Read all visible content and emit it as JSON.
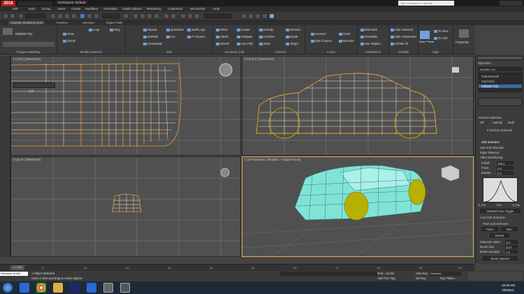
{
  "app": {
    "logo": "2016",
    "workspace": "Workspace: Default",
    "search_placeholder": "Type a keyword or phrase"
  },
  "menu": [
    "Edit",
    "Tools",
    "Group",
    "Views",
    "Create",
    "Modifiers",
    "Animation",
    "Graph Editors",
    "Rendering",
    "Customize",
    "MAXScript",
    "Help"
  ],
  "ribbon_tabs": [
    "Graphite Modeling Tools",
    "Freeform",
    "Selection",
    "Object Paint"
  ],
  "ribbon": {
    "groups": [
      "Polygon Modeling",
      "Modify Selection",
      "Edit",
      "Geometry (All)",
      "Vertices",
      "Loops",
      "Subdivision",
      "Visibility",
      "Align",
      "Properties"
    ],
    "modify": [
      "Grow",
      "Shrink",
      "Loop",
      "Ring"
    ],
    "edit": [
      "Repeat",
      "Quickslice",
      "Swift Loop",
      "NURMS",
      "Cut",
      "P Connect",
      "Constraints"
    ],
    "geometry": [
      "Relax",
      "Create",
      "Attach",
      "Collapse",
      "Detach",
      "Cap Poly"
    ],
    "vertices": [
      "Extrude",
      "Remove",
      "Chamfer",
      "Break",
      "Weld",
      "Target"
    ],
    "loops": [
      "Connect",
      "Insert",
      "Dist Connect",
      "Remove"
    ],
    "subdivision": [
      "MSmooth",
      "Tessellate",
      "Use Displac..."
    ],
    "visibility": [
      "Hide Selected",
      "Hide Unselected",
      "Unhide All"
    ],
    "align": [
      "Make Planar",
      "To View",
      "To Grid"
    ],
    "editable_poly": "Editable Poly"
  },
  "viewports": {
    "top": "[+] [Top ] [Wireframe]",
    "front": "[+] [Front ] [Wireframe]",
    "left": "[+] [Left ] [Wireframe]",
    "perspective": "[+] [Perspective ] [Realistic + Edged Faces]",
    "soft_label": "Soft"
  },
  "command_panel": {
    "object_name": "Object001",
    "modifier_list": "Modifier List",
    "stack": [
      "TurboSmooth",
      "Symmetry",
      "Editable Poly"
    ],
    "vertices_selected": "0 Vertices Selected",
    "preview_selection": "Preview Selection",
    "preview_opts": [
      "Off",
      "SubObj",
      "Multi"
    ],
    "soft_selection": "Soft Selection",
    "use_soft": "Use Soft Selection",
    "edge_distance": "Edge Distance:",
    "affect_backfacing": "Affect Backfacing",
    "falloff": "Falloff:",
    "falloff_val": "100.0",
    "pinch": "Pinch:",
    "pinch_val": "0.0",
    "bubble": "Bubble:",
    "bubble_val": "0.0",
    "curve_labels": [
      "11.30in",
      "0.0in",
      "11.30in"
    ],
    "shaded_face": "Shaded Face Toggle",
    "lock_soft": "Lock Soft Selection",
    "paint_soft": "Paint Soft Selection",
    "paint": "Paint",
    "blur": "Blur",
    "revert": "Revert",
    "selection_value": "Selection Value",
    "selection_value_num": "1.0",
    "brush_size": "Brush Size",
    "brush_size_num": "20.0",
    "brush_strength": "Brush Strength",
    "brush_strength_num": "1.0",
    "brush_options": "Brush Options"
  },
  "timeline": {
    "frame": "0 / 100",
    "ticks": [
      "0",
      "10",
      "20",
      "30",
      "40",
      "50",
      "60",
      "70",
      "80",
      "90",
      "100"
    ]
  },
  "status": {
    "selected": "1 Object Selected",
    "hint": "Click or click-and-drag to select objects",
    "grid": "Grid = 10.0in",
    "autokey": "Auto Key",
    "selected_mode": "Selected",
    "set_key": "Set Key",
    "key_filters": "Key Filters...",
    "add_time_tag": "Add Time Tag",
    "maxscript": "Welcome to MA"
  },
  "taskbar": {
    "time": "10:29 AM",
    "date": "7/9/2013"
  },
  "colors": {
    "car_body": "#7fe3d8",
    "wheel": "#b8b000",
    "wire_orange": "#e8a030",
    "accent": "#6fa0d8"
  }
}
